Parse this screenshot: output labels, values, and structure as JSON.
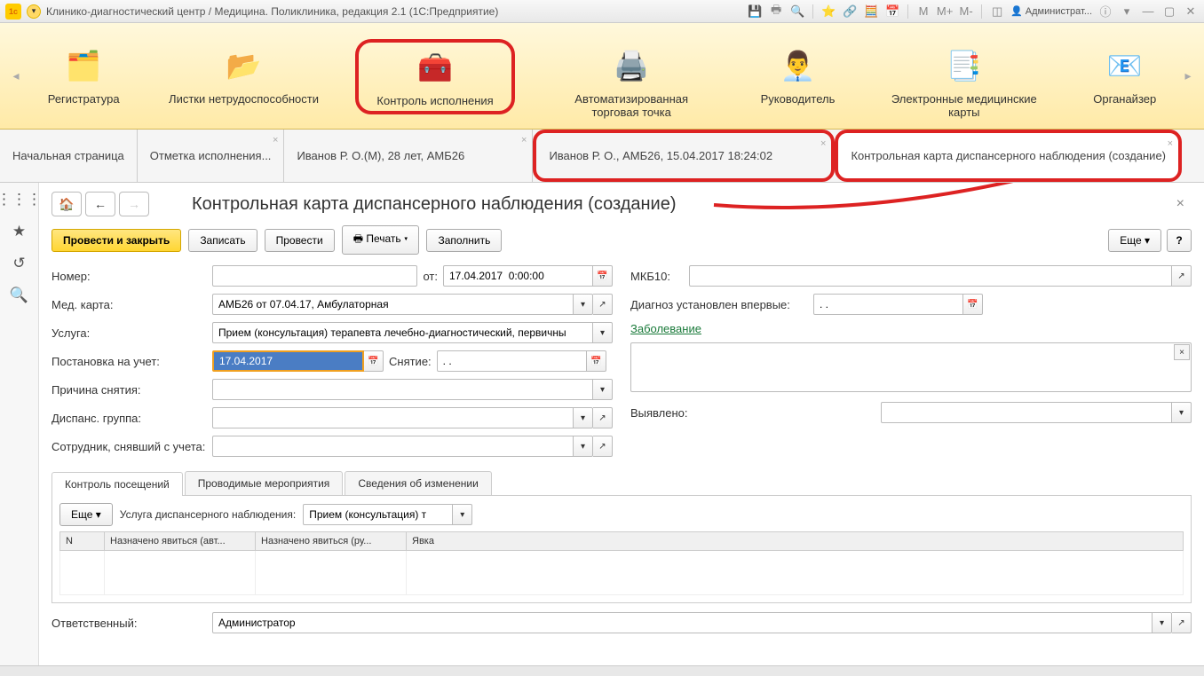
{
  "titlebar": {
    "title": "Клинико-диагностический центр / Медицина. Поликлиника, редакция 2.1  (1С:Предприятие)",
    "user": "Администрат..."
  },
  "ribbon": {
    "items": [
      {
        "label": "Регистратура",
        "icon": "📋"
      },
      {
        "label": "Листки нетрудоспособности",
        "icon": "📄"
      },
      {
        "label": "Контроль исполнения",
        "icon": "🧰"
      },
      {
        "label": "Автоматизированная торговая точка",
        "icon": "🖨️"
      },
      {
        "label": "Руководитель",
        "icon": "👨‍💼"
      },
      {
        "label": "Электронные медицинские карты",
        "icon": "📑"
      },
      {
        "label": "Органайзер",
        "icon": "📧"
      }
    ]
  },
  "tabs": [
    {
      "label": "Начальная страница"
    },
    {
      "label": "Отметка исполнения..."
    },
    {
      "label": "Иванов Р. О.(М), 28 лет, АМБ26"
    },
    {
      "label": "Иванов Р. О., АМБ26, 15.04.2017 18:24:02"
    },
    {
      "label": "Контрольная карта диспансерного наблюдения (создание)"
    }
  ],
  "page": {
    "title": "Контрольная карта диспансерного наблюдения (создание)"
  },
  "toolbar": {
    "post_close": "Провести и закрыть",
    "save": "Записать",
    "post": "Провести",
    "print": "Печать",
    "fill": "Заполнить",
    "more": "Еще",
    "help": "?"
  },
  "form": {
    "number_label": "Номер:",
    "number_value": "",
    "from_label": "от:",
    "from_value": "17.04.2017  0:00:00",
    "medcard_label": "Мед. карта:",
    "medcard_value": "АМБ26 от 07.04.17, Амбулаторная",
    "service_label": "Услуга:",
    "service_value": "Прием (консультация) терапевта лечебно-диагностический, первичны",
    "reg_label": "Постановка на учет:",
    "reg_value": "17.04.2017",
    "unreg_label": "Снятие:",
    "unreg_value": ". .",
    "unreg_reason_label": "Причина снятия:",
    "unreg_reason_value": "",
    "group_label": "Диспанс. группа:",
    "group_value": "",
    "unreg_emp_label": "Сотрудник, снявший с учета:",
    "unreg_emp_value": "",
    "mkb_label": "МКБ10:",
    "mkb_value": "",
    "first_diag_label": "Диагноз установлен впервые:",
    "first_diag_value": ". .",
    "disease_label": "Заболевание",
    "disease_value": "",
    "detected_label": "Выявлено:",
    "detected_value": "",
    "responsible_label": "Ответственный:",
    "responsible_value": "Администратор"
  },
  "subtabs": {
    "tab1": "Контроль посещений",
    "tab2": "Проводимые мероприятия",
    "tab3": "Сведения об изменении",
    "more": "Еще",
    "service_label": "Услуга диспансерного наблюдения:",
    "service_value": "Прием (консультация) т",
    "cols": {
      "n": "N",
      "c1": "Назначено явиться (авт...",
      "c2": "Назначено явиться (ру...",
      "c3": "Явка"
    }
  }
}
